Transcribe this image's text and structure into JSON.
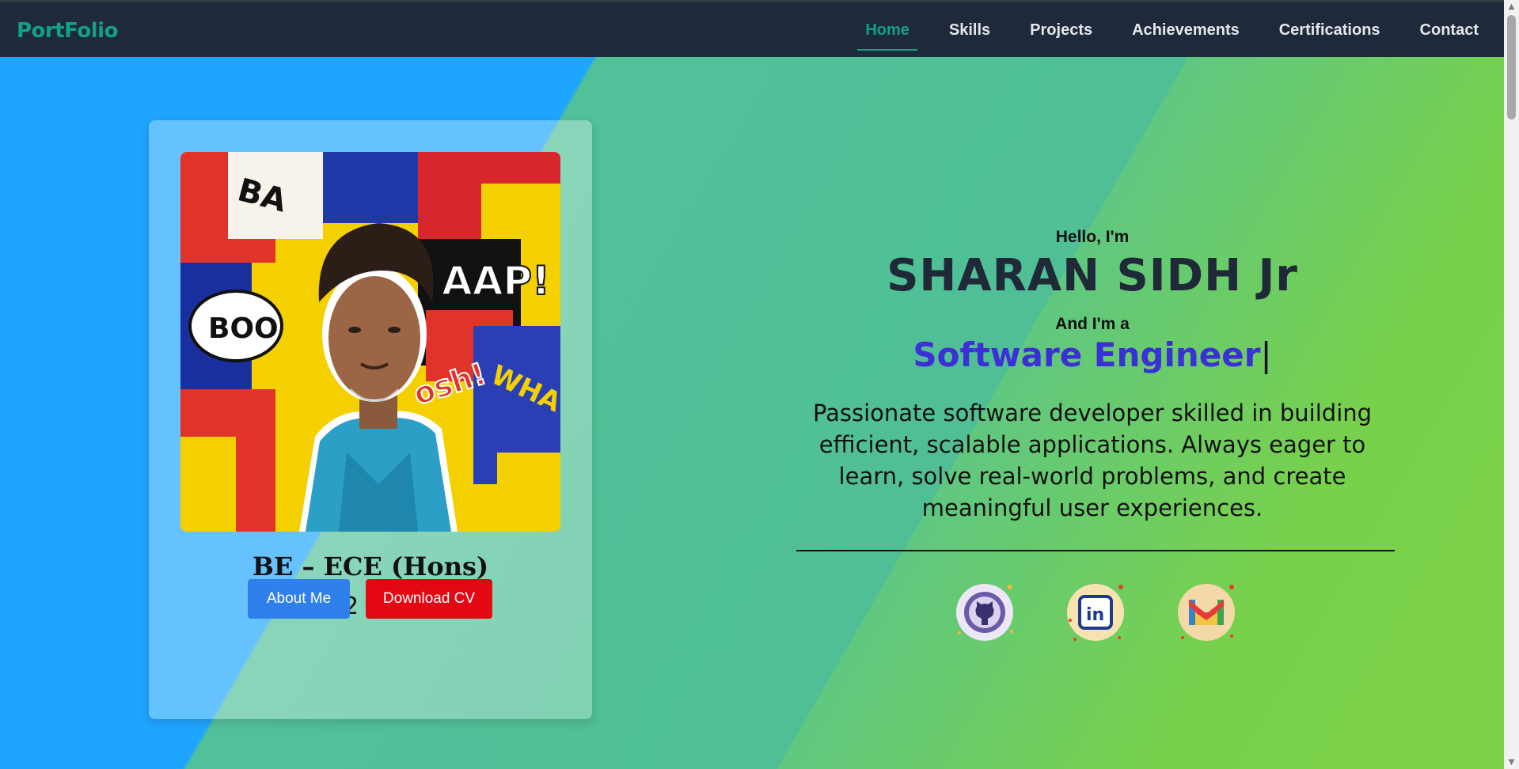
{
  "brand": {
    "name": "PortFolio"
  },
  "nav": {
    "items": [
      {
        "label": "Home",
        "active": true
      },
      {
        "label": "Skills"
      },
      {
        "label": "Projects"
      },
      {
        "label": "Achievements"
      },
      {
        "label": "Certifications"
      },
      {
        "label": "Contact"
      }
    ]
  },
  "profile": {
    "degree": "BE – ECE (Hons)",
    "years": "2022 - 2026",
    "about_label": "About Me",
    "cv_label": "Download CV"
  },
  "intro": {
    "greeting": "Hello, I'm",
    "name": "SHARAN SIDH Jr",
    "role_prefix": "And I'm a",
    "role": "Software Engineer",
    "cursor": "|",
    "description": "Passionate software developer skilled in building efficient, scalable applications. Always eager to learn, solve real-world problems, and create meaningful user experiences."
  },
  "socials": [
    {
      "icon": "github-icon"
    },
    {
      "icon": "linkedin-icon",
      "label": "in"
    },
    {
      "icon": "gmail-icon"
    }
  ],
  "colors": {
    "nav_bg": "#1e293b",
    "accent": "#14a085",
    "role": "#3b2fd6",
    "cv_button": "#e30613",
    "about_button": "#2f80ed"
  }
}
